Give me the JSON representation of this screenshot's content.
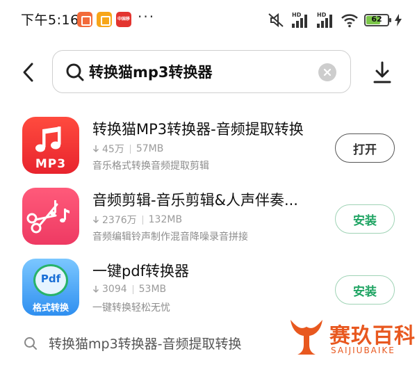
{
  "status_bar": {
    "time": "下午5:16",
    "notification_app_3": "中国移动",
    "more": "···",
    "battery_percent": "62",
    "signal_1_label": "HD",
    "signal_2_label": "HD"
  },
  "header": {
    "search_value": "转换猫mp3转换器",
    "back_icon": "chevron-left-icon",
    "clear_icon": "close-icon",
    "download_icon": "download-icon"
  },
  "results": [
    {
      "name": "转换猫MP3转换器-音频提取转换",
      "downloads": "45万",
      "size": "57MB",
      "description": "音乐格式转换音频提取剪辑",
      "action": "打开",
      "icon_label": "MP3"
    },
    {
      "name": "音频剪辑-音乐剪辑&人声伴奏...",
      "downloads": "2376万",
      "size": "132MB",
      "description": "音频编辑铃声制作混音降噪录音拼接",
      "action": "安装"
    },
    {
      "name": "一键pdf转换器",
      "downloads": "3094",
      "size": "53MB",
      "description": "一键转换轻松无忧",
      "action": "安装",
      "icon_label": "格式转换",
      "icon_badge": "Pdf"
    }
  ],
  "suggestion": {
    "text": "转换猫mp3转换器-音频提取转换"
  },
  "watermark": {
    "title": "赛玖百科",
    "subtitle": "SAIJIUBAIKE"
  },
  "colors": {
    "install_green": "#1fa463",
    "watermark_orange": "#e8581f"
  }
}
